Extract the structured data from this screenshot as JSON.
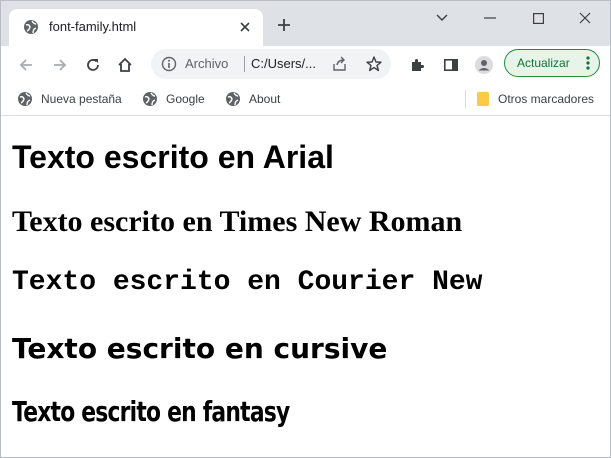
{
  "tab": {
    "title": "font-family.html"
  },
  "omnibox": {
    "label": "Archivo",
    "url": "C:/Users/..."
  },
  "toolbar": {
    "update_label": "Actualizar"
  },
  "bookmarks": {
    "items": [
      {
        "label": "Nueva pestaña",
        "icon": "globe-icon"
      },
      {
        "label": "Google",
        "icon": "globe-icon"
      },
      {
        "label": "About",
        "icon": "globe-icon"
      }
    ],
    "other": "Otros marcadores"
  },
  "page": {
    "lines": [
      "Texto escrito en Arial",
      "Texto escrito en Times New Roman",
      "Texto escrito en Courier New",
      "Texto escrito en cursive",
      "Texto escrito en fantasy"
    ]
  },
  "colors": {
    "tabstrip": "#dee1e6",
    "update_border": "#1e8e3e",
    "update_text": "#137333",
    "folder": "#fbcb48"
  }
}
